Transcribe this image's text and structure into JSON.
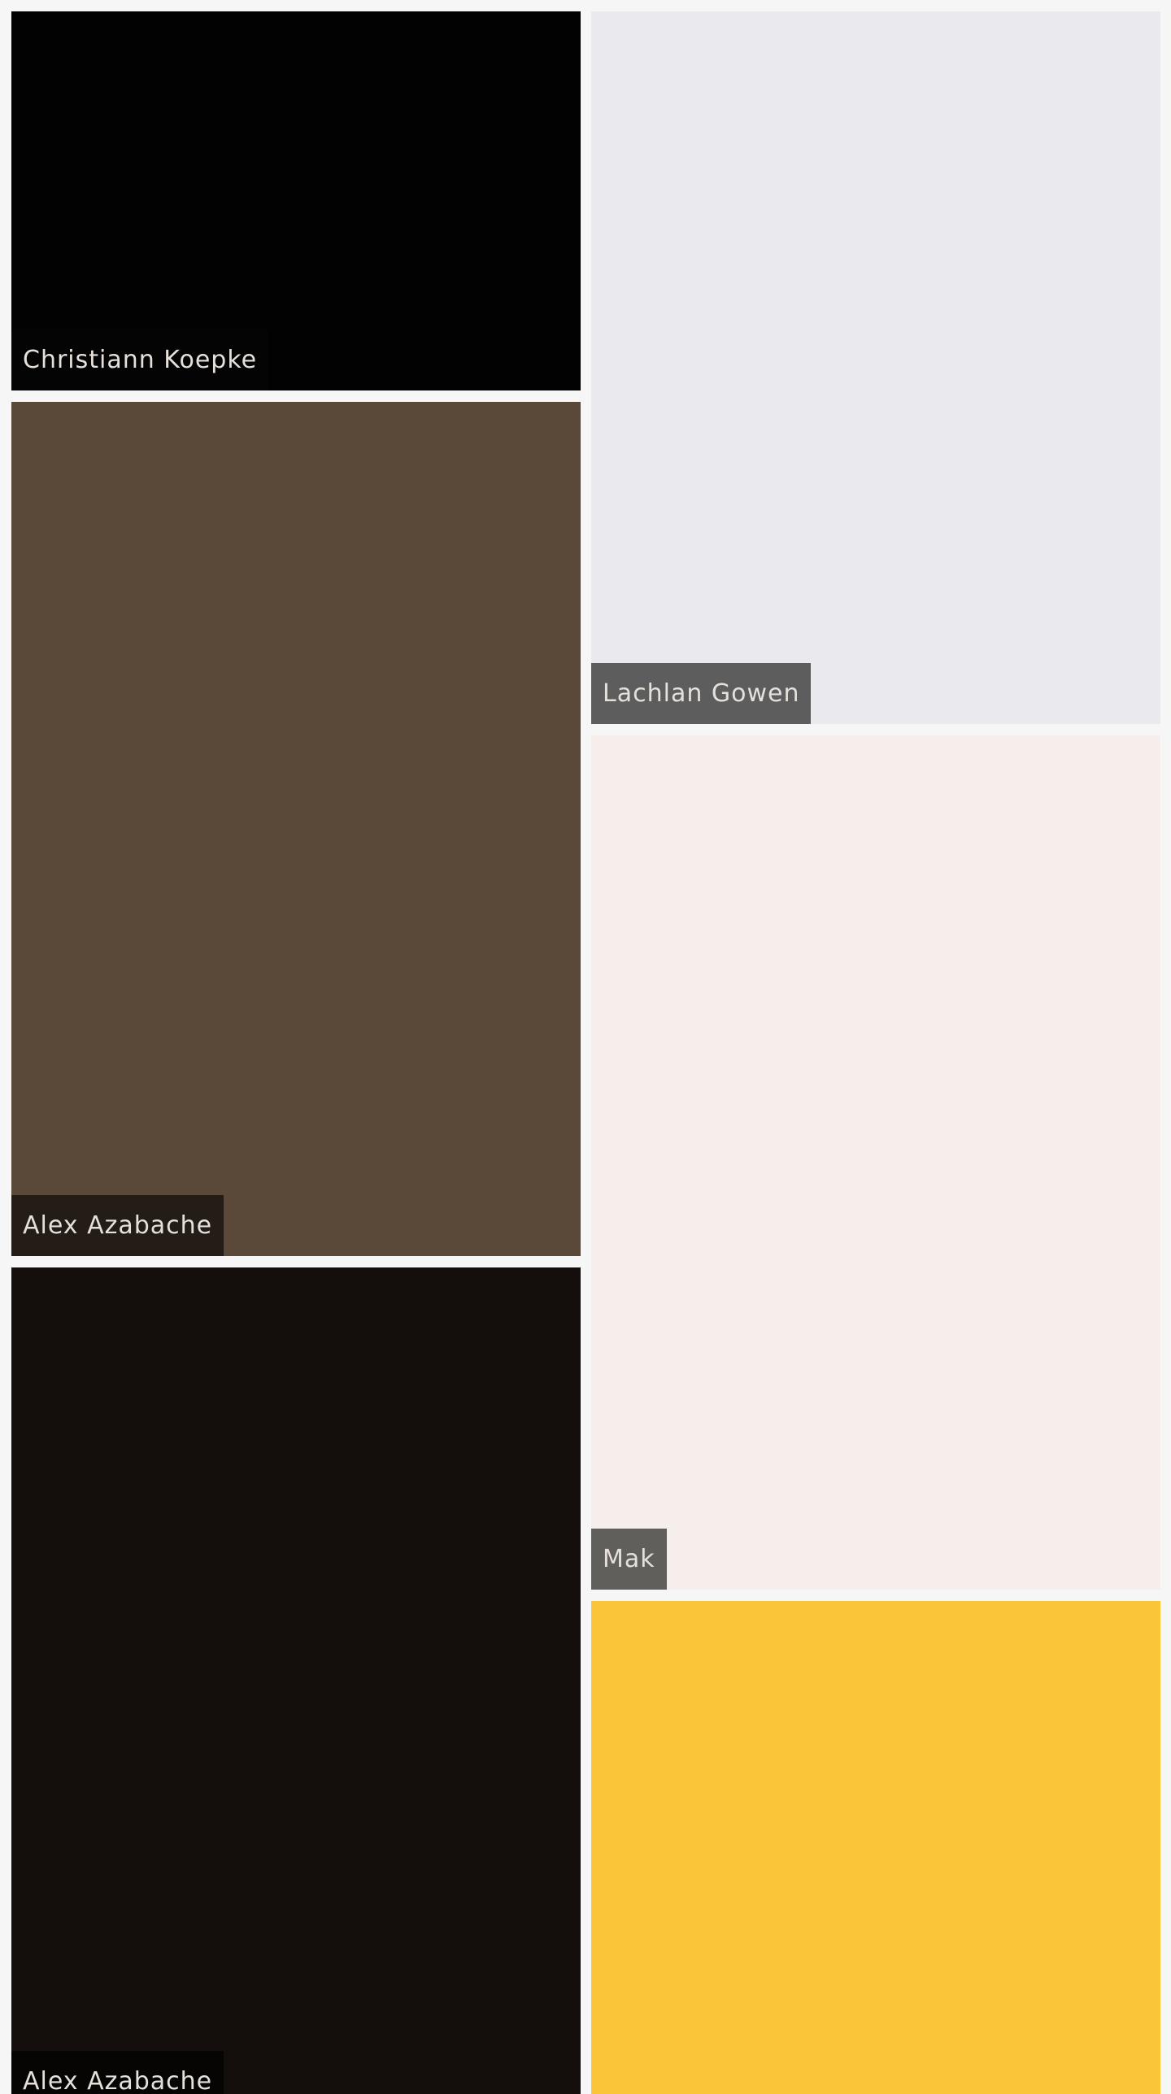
{
  "gallery": {
    "photos": [
      {
        "photographer": "Christiann Koepke",
        "color": "#030203",
        "caption_bg": "#050405"
      },
      {
        "photographer": "Alex Azabache",
        "color": "#5a4938",
        "caption_bg": "#241c17"
      },
      {
        "photographer": "Alex Azabache",
        "color": "#140f0c",
        "caption_bg": "#060504"
      },
      {
        "photographer": "Lachlan Gowen",
        "color": "#eae9ee",
        "caption_bg": "#5d5d5d"
      },
      {
        "photographer": "Mak",
        "color": "#f6eeea",
        "caption_bg": "#615f5c"
      },
      {
        "photographer": "",
        "color": "#fbc53a",
        "caption_bg": ""
      }
    ]
  }
}
